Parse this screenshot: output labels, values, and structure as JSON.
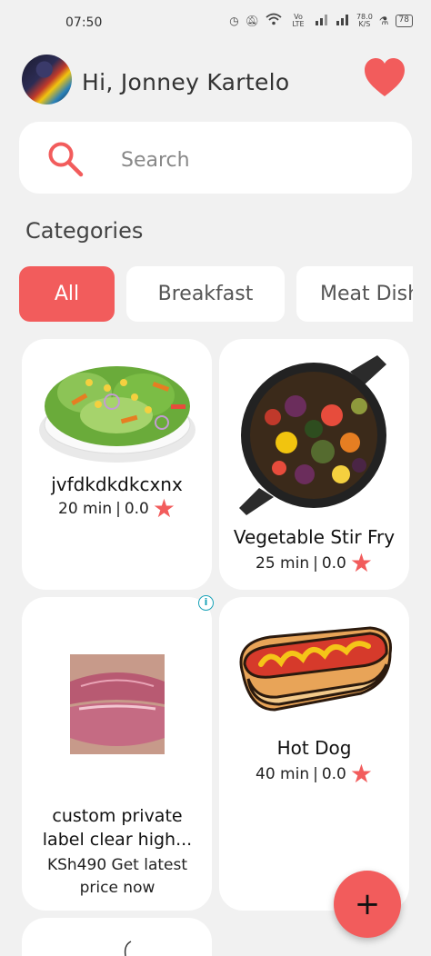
{
  "status_bar": {
    "time": "07:50",
    "network": "Vo LTE",
    "speed_value": "78.0",
    "speed_unit": "K/S",
    "battery": "78"
  },
  "header": {
    "greeting": "Hi, Jonney Kartelo",
    "favorite_icon": "heart-icon"
  },
  "search": {
    "placeholder": "Search",
    "icon": "search-icon"
  },
  "categories": {
    "title": "Categories",
    "items": [
      {
        "label": "All",
        "active": true
      },
      {
        "label": "Breakfast",
        "active": false
      },
      {
        "label": "Meat Dishes",
        "active": false
      }
    ]
  },
  "recipes": [
    {
      "title": "jvfdkdkdkcxnx",
      "time": "20 min",
      "rating": "0.0",
      "image": "salad-image"
    },
    {
      "title": "Vegetable Stir Fry",
      "time": "25 min",
      "rating": "0.0",
      "image": "stir-fry-image"
    },
    {
      "title": "Hot Dog",
      "time": "40 min",
      "rating": "0.0",
      "image": "hot-dog-image"
    }
  ],
  "ad": {
    "title": "custom private label clear high...",
    "price": "KSh490 Get latest price now",
    "image": "lip-gloss-image"
  },
  "fab": {
    "label": "+"
  },
  "colors": {
    "accent": "#f25c5c",
    "background": "#f1f1f1",
    "card": "#ffffff"
  }
}
